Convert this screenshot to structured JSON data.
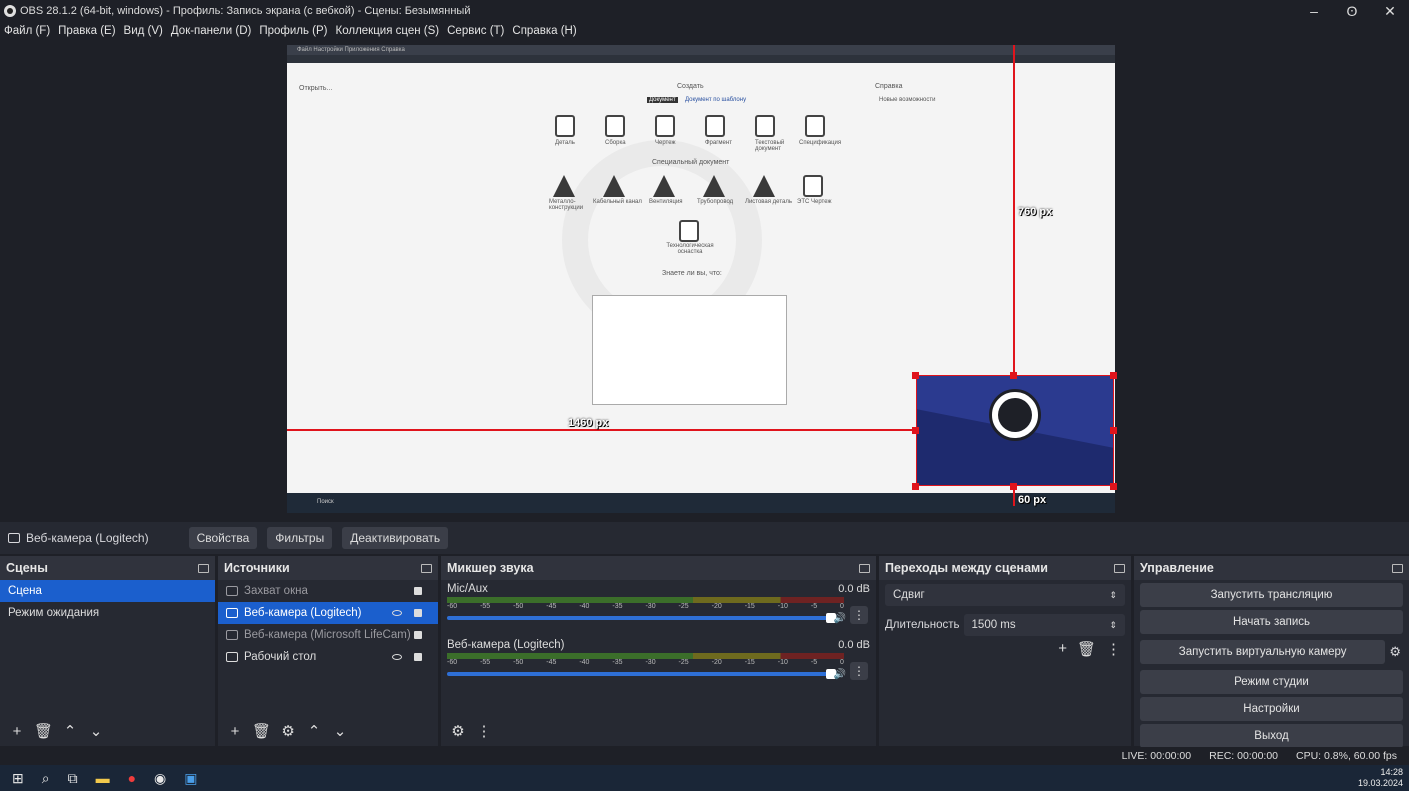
{
  "window": {
    "title": "OBS 28.1.2 (64-bit, windows) - Профиль: Запись экрана (с вебкой) - Сцены: Безымянный",
    "minimize": "–",
    "restore": "ʘ",
    "close": "✕"
  },
  "menu": [
    "Файл (F)",
    "Правка (E)",
    "Вид (V)",
    "Док-панели (D)",
    "Профиль (P)",
    "Коллекция сцен (S)",
    "Сервис (T)",
    "Справка (H)"
  ],
  "preview": {
    "kompas": {
      "menu": "Файл  Настройки  Приложения  Справка",
      "open": "Открыть...",
      "create": "Создать",
      "doc_btn": "Документ",
      "doc_tpl": "Документ по шаблону",
      "special": "Специальный документ",
      "help": "Справка",
      "news": "Новые возможности",
      "did_you_know": "Знаете ли вы, что:",
      "icons_row1": [
        "Деталь",
        "Сборка",
        "Чертеж",
        "Фрагмент",
        "Текстовый документ",
        "Спецификация"
      ],
      "icons_row2": [
        "Металло-конструкции",
        "Кабельный канал",
        "Вентиляция",
        "Трубопровод",
        "Листовая деталь",
        "ЭТС Чертеж"
      ],
      "tech": "Технологическая оснастка",
      "search": "Поиск"
    },
    "measure_height": "760 px",
    "measure_width": "1460 px",
    "measure_small": "60 px"
  },
  "context": {
    "source": "Веб-камера (Logitech)",
    "properties": "Свойства",
    "filters": "Фильтры",
    "deactivate": "Деактивировать"
  },
  "scenes": {
    "title": "Сцены",
    "items": [
      "Сцена",
      "Режим ожидания"
    ]
  },
  "sources": {
    "title": "Источники",
    "items": [
      {
        "label": "Захват окна",
        "state": "dim"
      },
      {
        "label": "Веб-камера (Logitech)",
        "state": "sel"
      },
      {
        "label": "Веб-камера (Microsoft LifeCam)",
        "state": "dim"
      },
      {
        "label": "Рабочий стол",
        "state": "normal"
      }
    ]
  },
  "mixer": {
    "title": "Микшер звука",
    "tracks": [
      {
        "name": "Mic/Aux",
        "db": "0.0 dB"
      },
      {
        "name": "Веб-камера (Logitech)",
        "db": "0.0 dB"
      }
    ],
    "ticks": [
      "-60",
      "-55",
      "-50",
      "-45",
      "-40",
      "-35",
      "-30",
      "-25",
      "-20",
      "-15",
      "-10",
      "-5",
      "0"
    ]
  },
  "transitions": {
    "title": "Переходы между сценами",
    "type": "Сдвиг",
    "duration_label": "Длительность",
    "duration": "1500 ms"
  },
  "controls": {
    "title": "Управление",
    "buttons": [
      "Запустить трансляцию",
      "Начать запись",
      "Запустить виртуальную камеру",
      "Режим студии",
      "Настройки",
      "Выход"
    ]
  },
  "status": {
    "live": "LIVE: 00:00:00",
    "rec": "REC: 00:00:00",
    "cpu": "CPU: 0.8%, 60.00 fps"
  },
  "taskbar": {
    "time": "14:28",
    "date": "19.03.2024"
  }
}
